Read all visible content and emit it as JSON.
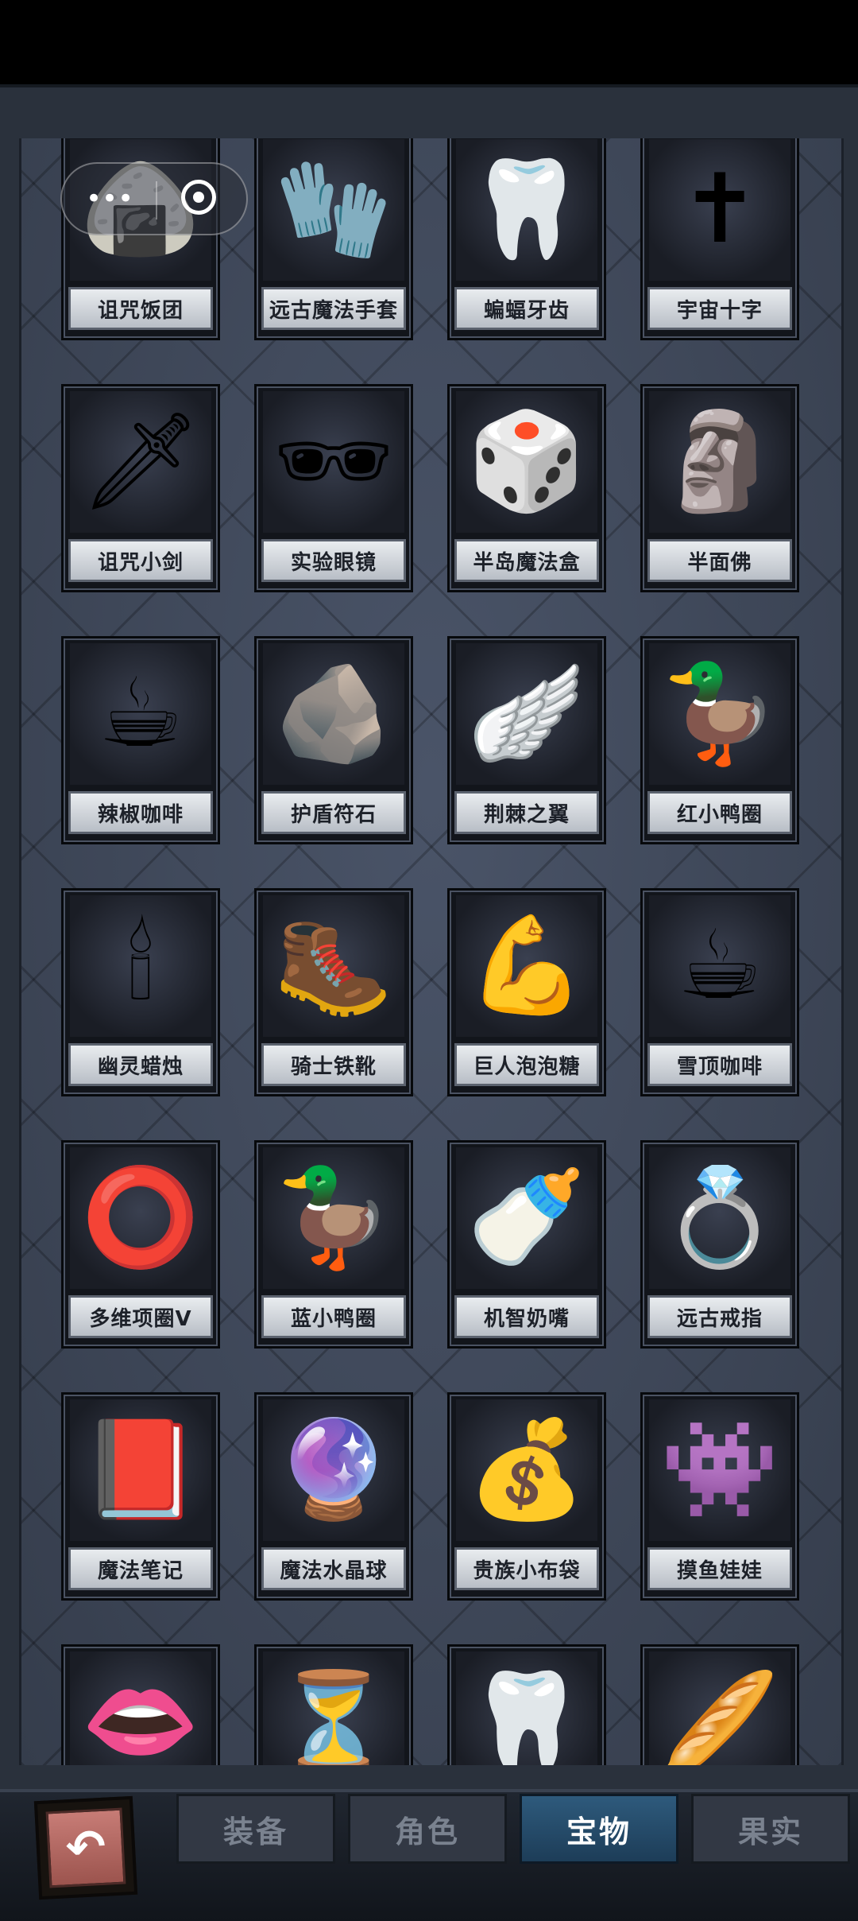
{
  "miniprogram_capsule": {
    "more_glyph": "•••"
  },
  "items": [
    {
      "name": "诅咒饭团",
      "icon": "🍙"
    },
    {
      "name": "远古魔法手套",
      "icon": "🧤"
    },
    {
      "name": "蝙蝠牙齿",
      "icon": "🦷"
    },
    {
      "name": "宇宙十字",
      "icon": "✝"
    },
    {
      "name": "诅咒小剑",
      "icon": "🗡"
    },
    {
      "name": "实验眼镜",
      "icon": "🕶"
    },
    {
      "name": "半岛魔法盒",
      "icon": "🎲"
    },
    {
      "name": "半面佛",
      "icon": "🗿"
    },
    {
      "name": "辣椒咖啡",
      "icon": "☕"
    },
    {
      "name": "护盾符石",
      "icon": "🪨"
    },
    {
      "name": "荆棘之翼",
      "icon": "🪽"
    },
    {
      "name": "红小鸭圈",
      "icon": "🦆"
    },
    {
      "name": "幽灵蜡烛",
      "icon": "🕯"
    },
    {
      "name": "骑士铁靴",
      "icon": "🥾"
    },
    {
      "name": "巨人泡泡糖",
      "icon": "💪"
    },
    {
      "name": "雪顶咖啡",
      "icon": "☕"
    },
    {
      "name": "多维项圈V",
      "icon": "⭕"
    },
    {
      "name": "蓝小鸭圈",
      "icon": "🦆"
    },
    {
      "name": "机智奶嘴",
      "icon": "🍼"
    },
    {
      "name": "远古戒指",
      "icon": "💍"
    },
    {
      "name": "魔法笔记",
      "icon": "📕"
    },
    {
      "name": "魔法水晶球",
      "icon": "🔮"
    },
    {
      "name": "贵族小布袋",
      "icon": "💰"
    },
    {
      "name": "摸鱼娃娃",
      "icon": "👾"
    },
    {
      "name": "",
      "icon": "👄"
    },
    {
      "name": "",
      "icon": "⏳"
    },
    {
      "name": "",
      "icon": "🦷"
    },
    {
      "name": "",
      "icon": "🥖"
    }
  ],
  "back_button": {
    "glyph": "↶"
  },
  "tabs": [
    {
      "label": "装备",
      "active": false
    },
    {
      "label": "角色",
      "active": false
    },
    {
      "label": "宝物",
      "active": true
    },
    {
      "label": "果实",
      "active": false
    }
  ]
}
